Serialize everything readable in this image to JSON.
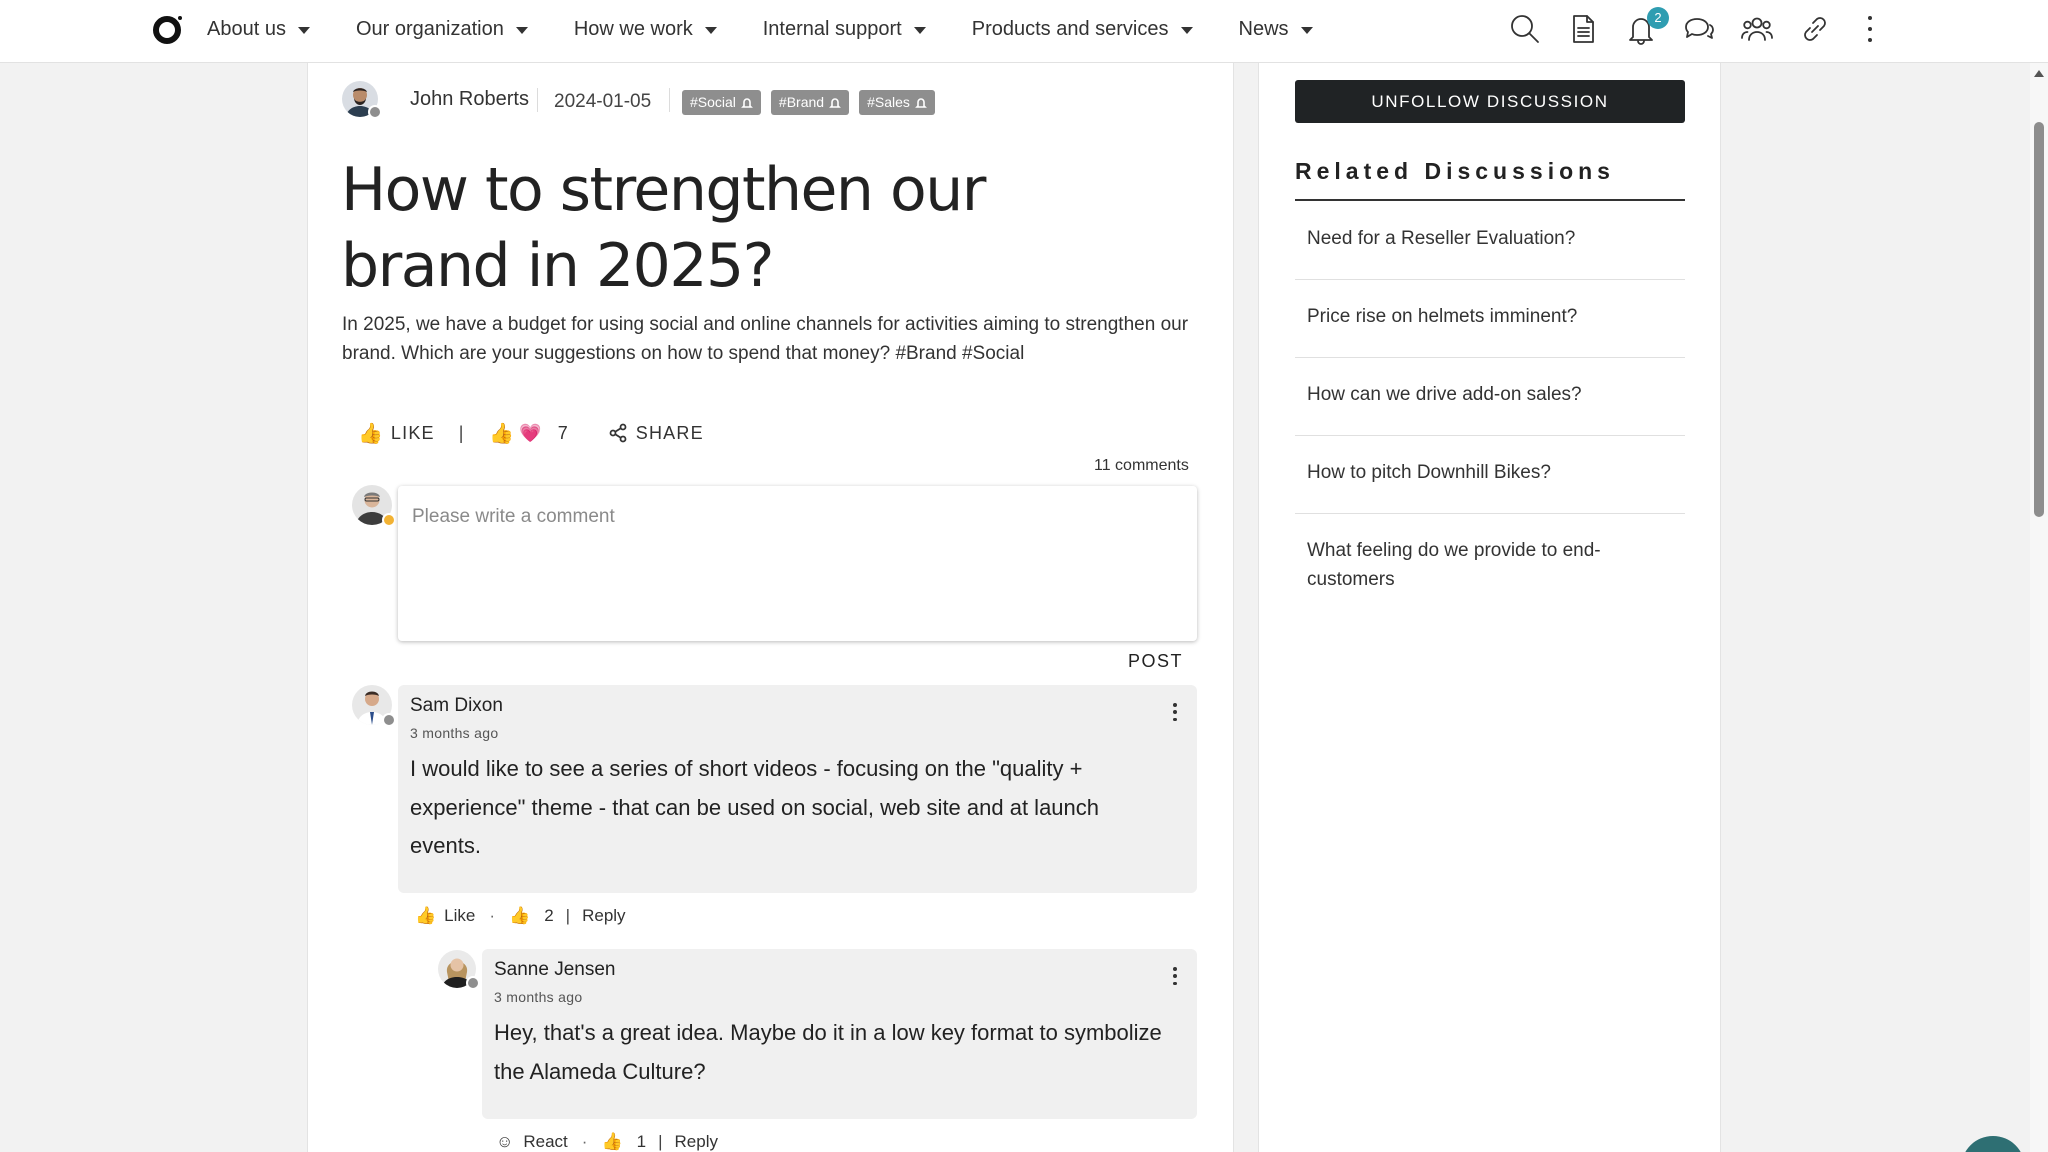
{
  "nav": {
    "items": [
      {
        "label": "About us"
      },
      {
        "label": "Our organization"
      },
      {
        "label": "How we work"
      },
      {
        "label": "Internal support"
      },
      {
        "label": "Products and services"
      },
      {
        "label": "News"
      }
    ],
    "icons": [
      "search-icon",
      "document-icon",
      "bell-icon",
      "chat-icon",
      "people-icon",
      "link-icon",
      "more-vertical-icon"
    ],
    "notification_count": "2"
  },
  "post": {
    "author": "John Roberts",
    "date": "2024-01-05",
    "tags": [
      "#Social",
      "#Brand",
      "#Sales"
    ],
    "title": "How to strengthen our brand in 2025?",
    "body": "In 2025, we have a budget for using social and online channels for activities aiming to strengthen our brand. Which are your suggestions on how to spend that money? #Brand #Social",
    "like_label": "LIKE",
    "reaction_count": "7",
    "share_label": "SHARE",
    "comments_count": "11 comments"
  },
  "composer": {
    "placeholder": "Please write a comment",
    "post_label": "POST"
  },
  "comments": [
    {
      "name": "Sam Dixon",
      "time": "3 months ago",
      "text": "I would like to see a series of short videos - focusing on the \"quality + experience\" theme - that can be used on social, web site and at launch events.",
      "action_label": "Like",
      "reaction_count": "2",
      "reply_label": "Reply"
    },
    {
      "name": "Sanne Jensen",
      "time": "3 months ago",
      "text": "Hey, that's a great idea. Maybe do it in a low key format to symbolize the Alameda Culture?",
      "action_label": "React",
      "reaction_count": "1",
      "reply_label": "Reply"
    }
  ],
  "sidebar": {
    "unfollow_label": "UNFOLLOW DISCUSSION",
    "related_title": "Related Discussions",
    "related": [
      "Need for a Reseller Evaluation?",
      "Price rise on helmets imminent?",
      "How can we drive add-on sales?",
      "How to pitch Downhill Bikes?",
      "What feeling do we provide to end-customers"
    ]
  },
  "colors": {
    "accent": "#2f9db1",
    "button_dark": "#202325",
    "tag_grey": "#8e8e8e",
    "heart": "#c8327a"
  }
}
